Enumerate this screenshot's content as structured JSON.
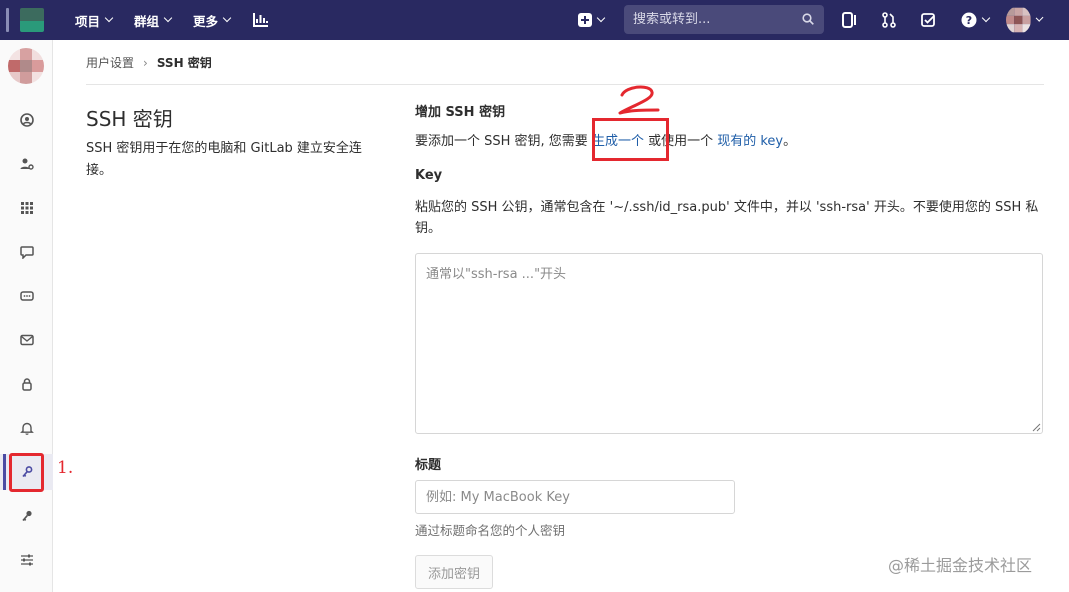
{
  "topnav": {
    "projects": "项目",
    "groups": "群组",
    "more": "更多",
    "search_placeholder": "搜索或转到..."
  },
  "breadcrumb": {
    "parent": "用户设置",
    "separator": "›",
    "current": "SSH 密钥"
  },
  "left": {
    "title": "SSH 密钥",
    "description": "SSH 密钥用于在您的电脑和 GitLab 建立安全连接。"
  },
  "form": {
    "section_title": "增加 SSH 密钥",
    "intro_prefix": "要添加一个 SSH 密钥, 您需要 ",
    "generate_link": "生成一个",
    "intro_middle": " 或使用一个 ",
    "existing_link": "现有的 key",
    "intro_suffix": "。",
    "key_label": "Key",
    "key_help": "粘贴您的 SSH 公钥，通常包含在 '~/.ssh/id_rsa.pub' 文件中，并以 'ssh-rsa' 开头。不要使用您的 SSH 私钥。",
    "key_placeholder": "通常以\"ssh-rsa ...\"开头",
    "title_label": "标题",
    "title_placeholder": "例如: My MacBook Key",
    "title_help": "通过标题命名您的个人密钥",
    "add_button": "添加密钥"
  },
  "annotations": {
    "step1": "1.",
    "color": "#e4282f"
  },
  "watermark": "@稀土掘金技术社区",
  "colors": {
    "nav": "#292961",
    "link": "#1f5ea8",
    "active_indicator": "#4b4ba3"
  }
}
